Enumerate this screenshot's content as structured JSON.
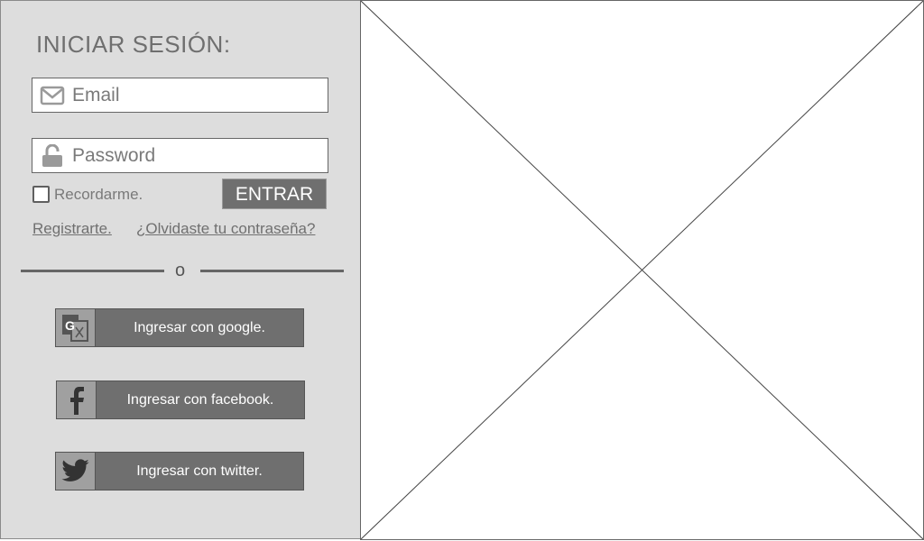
{
  "login": {
    "title": "INICIAR SESIÓN:",
    "email_placeholder": "Email",
    "password_placeholder": "Password",
    "remember_label": "Recordarme.",
    "enter_label": "ENTRAR",
    "register_link": "Registrarte.",
    "forgot_link": "¿Olvidaste tu contraseña?",
    "divider_text": "o"
  },
  "social": [
    {
      "label": "Ingresar con google.",
      "icon": "google-translate-icon"
    },
    {
      "label": "Ingresar con facebook.",
      "icon": "facebook-icon"
    },
    {
      "label": "Ingresar con twitter.",
      "icon": "twitter-icon"
    }
  ],
  "image_placeholder": {
    "icon": "image-placeholder-cross"
  },
  "colors": {
    "panel_bg": "#dddddd",
    "button_bg": "#6f6f6f",
    "icon_bg": "#a0a0a0",
    "text_gray": "#6f6f6f"
  }
}
